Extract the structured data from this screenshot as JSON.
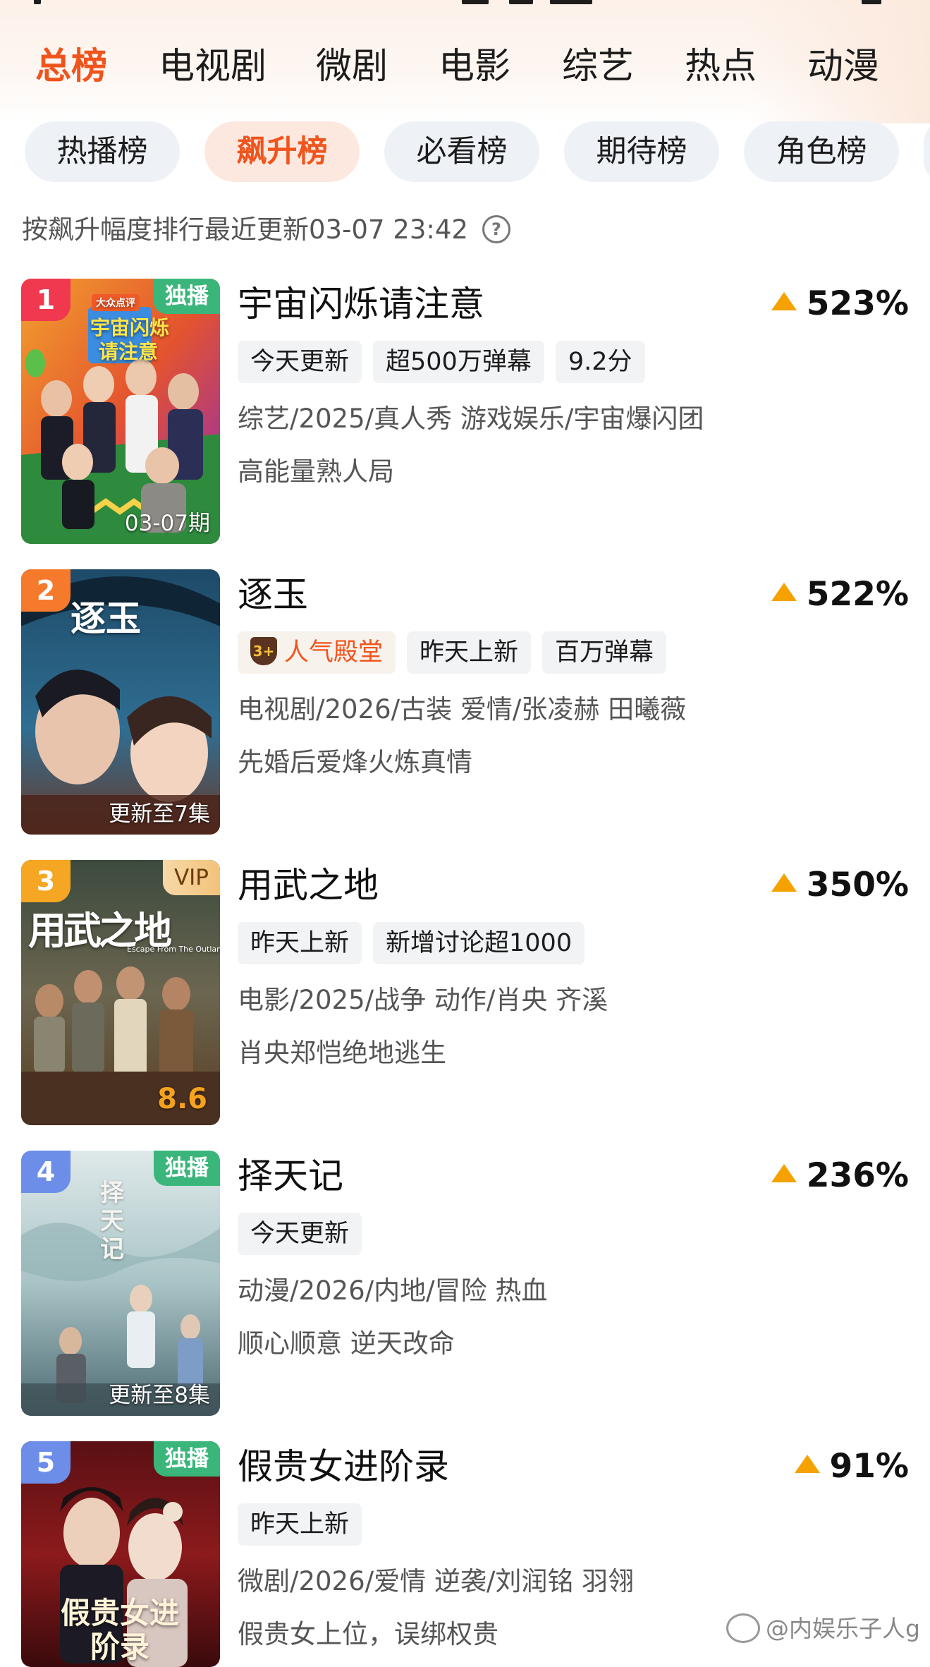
{
  "main_tabs": [
    {
      "label": "总榜",
      "active": true
    },
    {
      "label": "电视剧",
      "active": false
    },
    {
      "label": "微剧",
      "active": false
    },
    {
      "label": "电影",
      "active": false
    },
    {
      "label": "综艺",
      "active": false
    },
    {
      "label": "热点",
      "active": false
    },
    {
      "label": "动漫",
      "active": false
    }
  ],
  "sub_tabs": [
    {
      "label": "热播榜",
      "active": false
    },
    {
      "label": "飙升榜",
      "active": true
    },
    {
      "label": "必看榜",
      "active": false
    },
    {
      "label": "期待榜",
      "active": false
    },
    {
      "label": "角色榜",
      "active": false
    }
  ],
  "update_info": "按飙升幅度排行最近更新03-07 23:42",
  "help_icon": "?",
  "items": [
    {
      "rank": "1",
      "rank_color": "#f0384e",
      "corner_tag": "独播",
      "poster_caption": "03-07期",
      "poster_title_line1": "宇宙闪烁",
      "poster_title_line2": "请注意",
      "poster_logo": "大众点评",
      "title": "宇宙闪烁请注意",
      "growth": "523%",
      "tags": [
        "今天更新",
        "超500万弹幕",
        "9.2分"
      ],
      "meta": "综艺/2025/真人秀 游戏娱乐/宇宙爆闪团",
      "desc": "高能量熟人局"
    },
    {
      "rank": "2",
      "rank_color": "#f57a2b",
      "poster_caption": "更新至7集",
      "poster_title": "逐玉",
      "title": "逐玉",
      "growth": "522%",
      "hot_badge": {
        "icon": "3+",
        "label": "人气殿堂"
      },
      "tags": [
        "昨天上新",
        "百万弹幕"
      ],
      "meta": "电视剧/2026/古装 爱情/张凌赫 田曦薇",
      "desc": "先婚后爱烽火炼真情"
    },
    {
      "rank": "3",
      "rank_color": "#f5a623",
      "corner_tag": "VIP",
      "poster_score": "8.6",
      "poster_title": "用武之地",
      "poster_subtitle": "Escape From The Outland",
      "title": "用武之地",
      "growth": "350%",
      "tags": [
        "昨天上新",
        "新增讨论超1000"
      ],
      "meta": "电影/2025/战争 动作/肖央 齐溪",
      "desc": "肖央郑恺绝地逃生"
    },
    {
      "rank": "4",
      "rank_color": "#6c8ee8",
      "corner_tag": "独播",
      "poster_caption": "更新至8集",
      "poster_title": "择天记",
      "title": "择天记",
      "growth": "236%",
      "tags": [
        "今天更新"
      ],
      "meta": "动漫/2026/内地/冒险 热血",
      "desc": "顺心顺意 逆天改命"
    },
    {
      "rank": "5",
      "rank_color": "#6c8ee8",
      "corner_tag": "独播",
      "poster_title": "假贵女进阶录",
      "title": "假贵女进阶录",
      "growth": "91%",
      "tags": [
        "昨天上新"
      ],
      "meta": "微剧/2026/爱情 逆袭/刘润铭 羽翎",
      "desc": "假贵女上位，误绑权贵"
    }
  ],
  "watermark": "@内娱乐子人g"
}
